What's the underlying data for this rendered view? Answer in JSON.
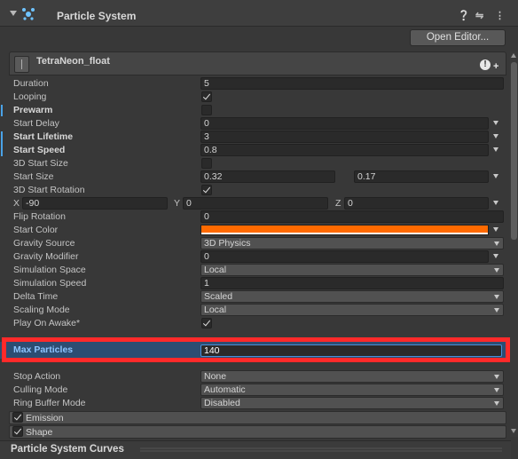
{
  "component": {
    "title": "Particle System",
    "open_editor_label": "Open Editor...",
    "icons": [
      "particle-system-icon",
      "help-icon",
      "preset-icon",
      "more-icon"
    ]
  },
  "tab": {
    "title": "TetraNeon_float",
    "icons": [
      "game-object-icon",
      "warning-icon",
      "plus-icon"
    ]
  },
  "fields": {
    "duration": {
      "label": "Duration",
      "value": "5"
    },
    "looping": {
      "label": "Looping",
      "checked": true
    },
    "prewarm": {
      "label": "Prewarm",
      "checked": false
    },
    "start_delay": {
      "label": "Start Delay",
      "value": "0"
    },
    "start_lifetime": {
      "label": "Start Lifetime",
      "value": "3"
    },
    "start_speed": {
      "label": "Start Speed",
      "value": "0.8"
    },
    "start_size_3d": {
      "label": "3D Start Size",
      "checked": false
    },
    "start_size": {
      "label": "Start Size",
      "value_min": "0.32",
      "value_max": "0.17"
    },
    "start_rotation_3d": {
      "label": "3D Start Rotation",
      "checked": true
    },
    "rotation_xyz": {
      "x_label": "X",
      "x": "-90",
      "y_label": "Y",
      "y": "0",
      "z_label": "Z",
      "z": "0"
    },
    "flip_rotation": {
      "label": "Flip Rotation",
      "value": "0"
    },
    "start_color": {
      "label": "Start Color",
      "color": "#ff6a00"
    },
    "gravity_source": {
      "label": "Gravity Source",
      "value": "3D Physics"
    },
    "gravity_modifier": {
      "label": "Gravity Modifier",
      "value": "0"
    },
    "simulation_space": {
      "label": "Simulation Space",
      "value": "Local"
    },
    "simulation_speed": {
      "label": "Simulation Speed",
      "value": "1"
    },
    "delta_time": {
      "label": "Delta Time",
      "value": "Scaled"
    },
    "scaling_mode": {
      "label": "Scaling Mode",
      "value": "Local"
    },
    "play_on_awake": {
      "label": "Play On Awake*",
      "checked": true
    },
    "max_particles": {
      "label": "Max Particles",
      "value": "140"
    },
    "stop_action": {
      "label": "Stop Action",
      "value": "None"
    },
    "culling_mode": {
      "label": "Culling Mode",
      "value": "Automatic"
    },
    "ring_buffer_mode": {
      "label": "Ring Buffer Mode",
      "value": "Disabled"
    }
  },
  "modules": [
    {
      "label": "Emission",
      "checked": true
    },
    {
      "label": "Shape",
      "checked": true
    }
  ],
  "curves": {
    "title": "Particle System Curves"
  },
  "colors": {
    "highlight_border": "#ff2a2a",
    "selected_row": "#2c4d72",
    "accent": "#4aa3e8"
  }
}
